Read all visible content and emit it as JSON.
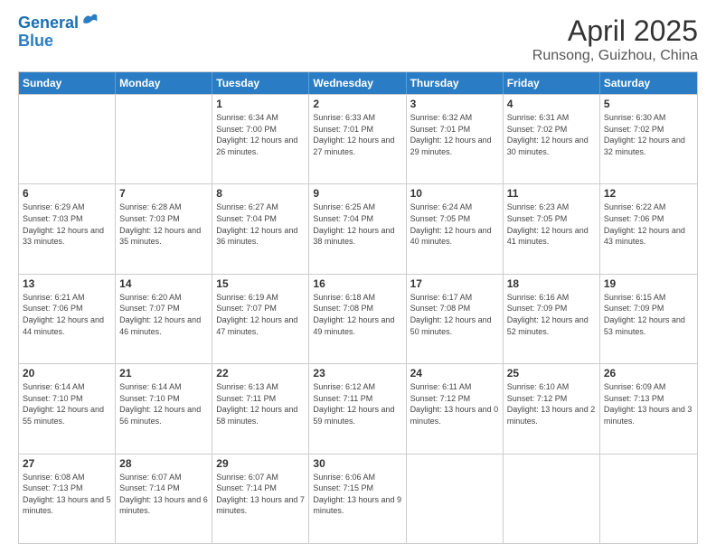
{
  "header": {
    "logo_line1": "General",
    "logo_line2": "Blue",
    "title": "April 2025",
    "subtitle": "Runsong, Guizhou, China"
  },
  "calendar": {
    "days_of_week": [
      "Sunday",
      "Monday",
      "Tuesday",
      "Wednesday",
      "Thursday",
      "Friday",
      "Saturday"
    ],
    "weeks": [
      [
        {
          "day": "",
          "sunrise": "",
          "sunset": "",
          "daylight": ""
        },
        {
          "day": "",
          "sunrise": "",
          "sunset": "",
          "daylight": ""
        },
        {
          "day": "1",
          "sunrise": "Sunrise: 6:34 AM",
          "sunset": "Sunset: 7:00 PM",
          "daylight": "Daylight: 12 hours and 26 minutes."
        },
        {
          "day": "2",
          "sunrise": "Sunrise: 6:33 AM",
          "sunset": "Sunset: 7:01 PM",
          "daylight": "Daylight: 12 hours and 27 minutes."
        },
        {
          "day": "3",
          "sunrise": "Sunrise: 6:32 AM",
          "sunset": "Sunset: 7:01 PM",
          "daylight": "Daylight: 12 hours and 29 minutes."
        },
        {
          "day": "4",
          "sunrise": "Sunrise: 6:31 AM",
          "sunset": "Sunset: 7:02 PM",
          "daylight": "Daylight: 12 hours and 30 minutes."
        },
        {
          "day": "5",
          "sunrise": "Sunrise: 6:30 AM",
          "sunset": "Sunset: 7:02 PM",
          "daylight": "Daylight: 12 hours and 32 minutes."
        }
      ],
      [
        {
          "day": "6",
          "sunrise": "Sunrise: 6:29 AM",
          "sunset": "Sunset: 7:03 PM",
          "daylight": "Daylight: 12 hours and 33 minutes."
        },
        {
          "day": "7",
          "sunrise": "Sunrise: 6:28 AM",
          "sunset": "Sunset: 7:03 PM",
          "daylight": "Daylight: 12 hours and 35 minutes."
        },
        {
          "day": "8",
          "sunrise": "Sunrise: 6:27 AM",
          "sunset": "Sunset: 7:04 PM",
          "daylight": "Daylight: 12 hours and 36 minutes."
        },
        {
          "day": "9",
          "sunrise": "Sunrise: 6:25 AM",
          "sunset": "Sunset: 7:04 PM",
          "daylight": "Daylight: 12 hours and 38 minutes."
        },
        {
          "day": "10",
          "sunrise": "Sunrise: 6:24 AM",
          "sunset": "Sunset: 7:05 PM",
          "daylight": "Daylight: 12 hours and 40 minutes."
        },
        {
          "day": "11",
          "sunrise": "Sunrise: 6:23 AM",
          "sunset": "Sunset: 7:05 PM",
          "daylight": "Daylight: 12 hours and 41 minutes."
        },
        {
          "day": "12",
          "sunrise": "Sunrise: 6:22 AM",
          "sunset": "Sunset: 7:06 PM",
          "daylight": "Daylight: 12 hours and 43 minutes."
        }
      ],
      [
        {
          "day": "13",
          "sunrise": "Sunrise: 6:21 AM",
          "sunset": "Sunset: 7:06 PM",
          "daylight": "Daylight: 12 hours and 44 minutes."
        },
        {
          "day": "14",
          "sunrise": "Sunrise: 6:20 AM",
          "sunset": "Sunset: 7:07 PM",
          "daylight": "Daylight: 12 hours and 46 minutes."
        },
        {
          "day": "15",
          "sunrise": "Sunrise: 6:19 AM",
          "sunset": "Sunset: 7:07 PM",
          "daylight": "Daylight: 12 hours and 47 minutes."
        },
        {
          "day": "16",
          "sunrise": "Sunrise: 6:18 AM",
          "sunset": "Sunset: 7:08 PM",
          "daylight": "Daylight: 12 hours and 49 minutes."
        },
        {
          "day": "17",
          "sunrise": "Sunrise: 6:17 AM",
          "sunset": "Sunset: 7:08 PM",
          "daylight": "Daylight: 12 hours and 50 minutes."
        },
        {
          "day": "18",
          "sunrise": "Sunrise: 6:16 AM",
          "sunset": "Sunset: 7:09 PM",
          "daylight": "Daylight: 12 hours and 52 minutes."
        },
        {
          "day": "19",
          "sunrise": "Sunrise: 6:15 AM",
          "sunset": "Sunset: 7:09 PM",
          "daylight": "Daylight: 12 hours and 53 minutes."
        }
      ],
      [
        {
          "day": "20",
          "sunrise": "Sunrise: 6:14 AM",
          "sunset": "Sunset: 7:10 PM",
          "daylight": "Daylight: 12 hours and 55 minutes."
        },
        {
          "day": "21",
          "sunrise": "Sunrise: 6:14 AM",
          "sunset": "Sunset: 7:10 PM",
          "daylight": "Daylight: 12 hours and 56 minutes."
        },
        {
          "day": "22",
          "sunrise": "Sunrise: 6:13 AM",
          "sunset": "Sunset: 7:11 PM",
          "daylight": "Daylight: 12 hours and 58 minutes."
        },
        {
          "day": "23",
          "sunrise": "Sunrise: 6:12 AM",
          "sunset": "Sunset: 7:11 PM",
          "daylight": "Daylight: 12 hours and 59 minutes."
        },
        {
          "day": "24",
          "sunrise": "Sunrise: 6:11 AM",
          "sunset": "Sunset: 7:12 PM",
          "daylight": "Daylight: 13 hours and 0 minutes."
        },
        {
          "day": "25",
          "sunrise": "Sunrise: 6:10 AM",
          "sunset": "Sunset: 7:12 PM",
          "daylight": "Daylight: 13 hours and 2 minutes."
        },
        {
          "day": "26",
          "sunrise": "Sunrise: 6:09 AM",
          "sunset": "Sunset: 7:13 PM",
          "daylight": "Daylight: 13 hours and 3 minutes."
        }
      ],
      [
        {
          "day": "27",
          "sunrise": "Sunrise: 6:08 AM",
          "sunset": "Sunset: 7:13 PM",
          "daylight": "Daylight: 13 hours and 5 minutes."
        },
        {
          "day": "28",
          "sunrise": "Sunrise: 6:07 AM",
          "sunset": "Sunset: 7:14 PM",
          "daylight": "Daylight: 13 hours and 6 minutes."
        },
        {
          "day": "29",
          "sunrise": "Sunrise: 6:07 AM",
          "sunset": "Sunset: 7:14 PM",
          "daylight": "Daylight: 13 hours and 7 minutes."
        },
        {
          "day": "30",
          "sunrise": "Sunrise: 6:06 AM",
          "sunset": "Sunset: 7:15 PM",
          "daylight": "Daylight: 13 hours and 9 minutes."
        },
        {
          "day": "",
          "sunrise": "",
          "sunset": "",
          "daylight": ""
        },
        {
          "day": "",
          "sunrise": "",
          "sunset": "",
          "daylight": ""
        },
        {
          "day": "",
          "sunrise": "",
          "sunset": "",
          "daylight": ""
        }
      ]
    ]
  }
}
